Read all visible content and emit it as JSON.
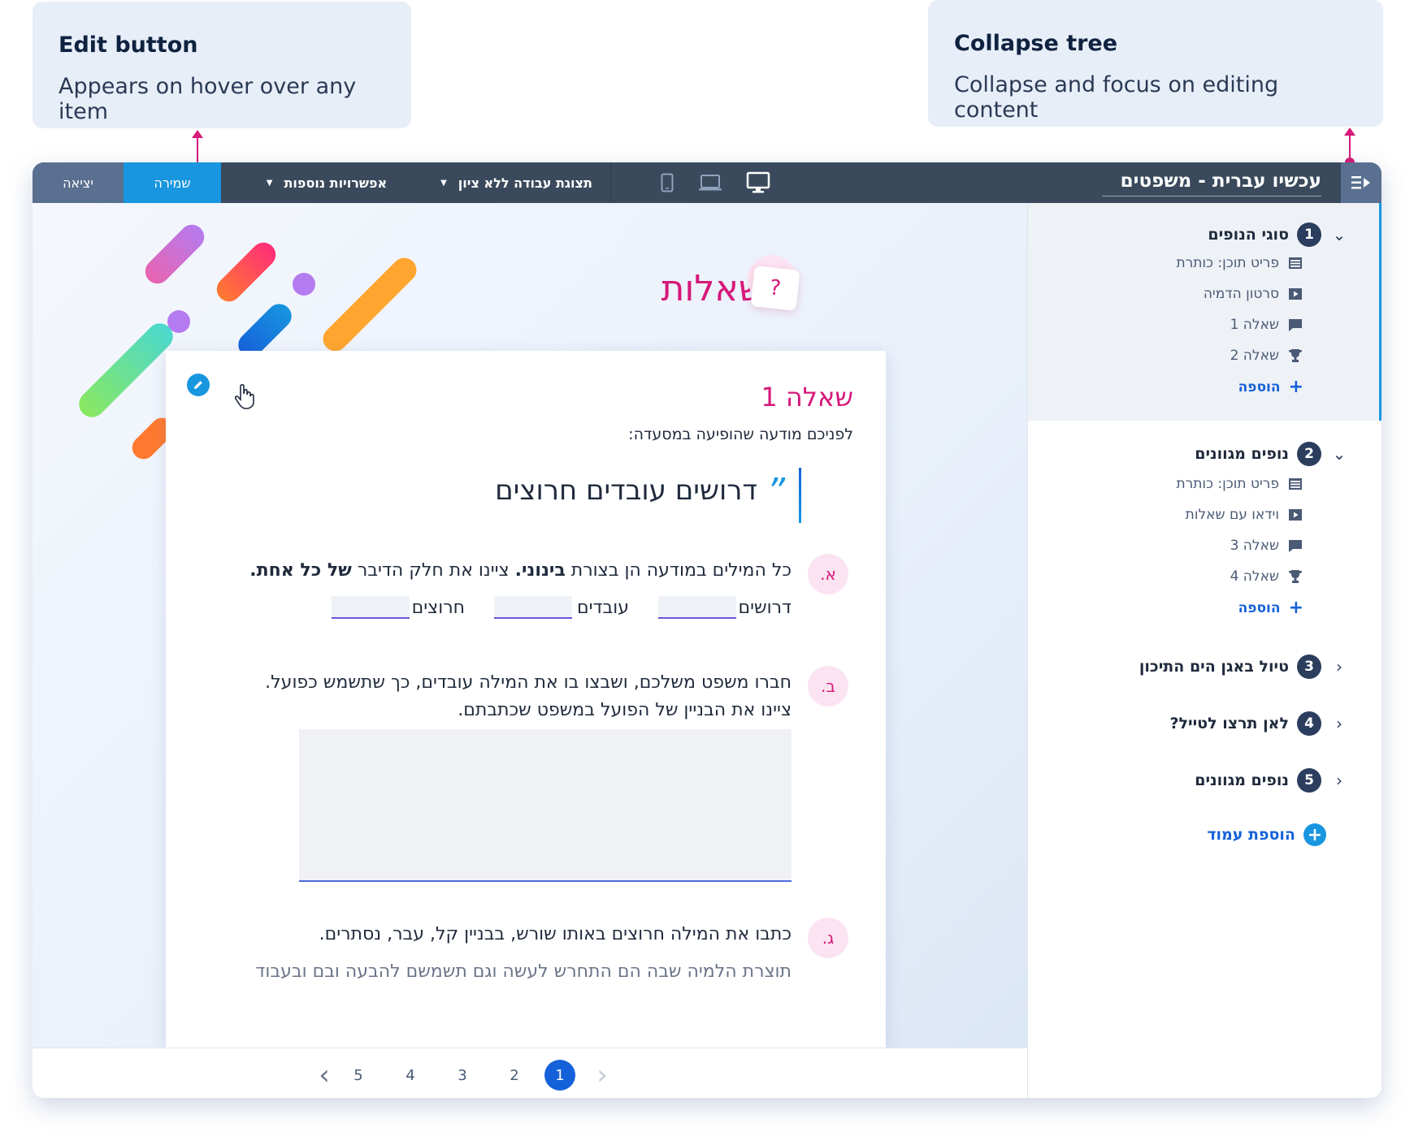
{
  "callouts": {
    "edit": {
      "title": "Edit button",
      "desc": "Appears on hover over any item"
    },
    "collapse": {
      "title": "Collapse tree",
      "desc": "Collapse and focus on editing content"
    }
  },
  "topbar": {
    "doc_title": "עכשיו עברית - משפטים",
    "exit_label": "יציאה",
    "save_label": "שמירה",
    "more_options_label": "אפשרויות נוספות",
    "view_mode_label": "תצוגת עבודה ללא ציון",
    "devices": [
      "mobile-icon",
      "laptop-icon",
      "desktop-icon"
    ]
  },
  "page": {
    "heading": "שאלות",
    "question_icon": "?"
  },
  "card": {
    "title": "שאלה 1",
    "intro": "לפניכם מודעה שהופיעה במסעדה:",
    "quote_mark": "”",
    "quote": "דרושים עובדים חרוצים",
    "q_a": {
      "badge": "א.",
      "text_pre": "כל המילים במודעה הן בצורת ",
      "text_bold1": "בינוני.",
      "text_mid": " ציינו את חלק הדיבר ",
      "text_bold2": "של כל אחת.",
      "words": [
        "דרושים",
        "עובדים",
        "חרוצים"
      ]
    },
    "q_b": {
      "badge": "ב.",
      "line1": "חברו משפט משלכם, ושבצו בו את המילה עובדים, כך שתשמש כפועל.",
      "line2": "ציינו את הבניין של הפועל במשפט שכתבתם."
    },
    "q_c": {
      "badge": "ג.",
      "line1": "כתבו את המילה חרוצים באותו שורש, בבניין קל, עבר, נסתרים.",
      "line2": "תוצרת הלמיה שבה הם התחרש לעשה וגם תשמשם להבעה ובם ובעבוד"
    }
  },
  "pager": {
    "pages": [
      "5",
      "4",
      "3",
      "2",
      "1"
    ],
    "active": "1"
  },
  "sidebar": {
    "sections": [
      {
        "num": "1",
        "title": "סוגי הנופים",
        "expanded": true,
        "items": [
          {
            "icon": "text-block-icon",
            "label": "פריט תוכן: כותרת"
          },
          {
            "icon": "video-icon",
            "label": "סרטון הדמיה"
          },
          {
            "icon": "comment-icon",
            "label": "שאלה 1"
          },
          {
            "icon": "trophy-icon",
            "label": "שאלה 2"
          }
        ],
        "add_label": "הוספה"
      },
      {
        "num": "2",
        "title": "נופים מגוונים",
        "expanded": true,
        "items": [
          {
            "icon": "text-block-icon",
            "label": "פריט תוכן: כותרת"
          },
          {
            "icon": "video-icon",
            "label": "וידאו עם שאלות"
          },
          {
            "icon": "comment-icon",
            "label": "שאלה 3"
          },
          {
            "icon": "trophy-icon",
            "label": "שאלה 4"
          }
        ],
        "add_label": "הוספה"
      },
      {
        "num": "3",
        "title": "טיול באגן הים התיכון",
        "expanded": false
      },
      {
        "num": "4",
        "title": "לאן תרצו לטייל?",
        "expanded": false
      },
      {
        "num": "5",
        "title": "נופים מגוונים",
        "expanded": false
      }
    ],
    "add_page_label": "הוספת עמוד"
  },
  "colors": {
    "topbar": "#3a4a5c",
    "save": "#1896e0",
    "exit": "#5a7090",
    "accent_pink": "#d6197a",
    "active_page": "#1561d9"
  }
}
